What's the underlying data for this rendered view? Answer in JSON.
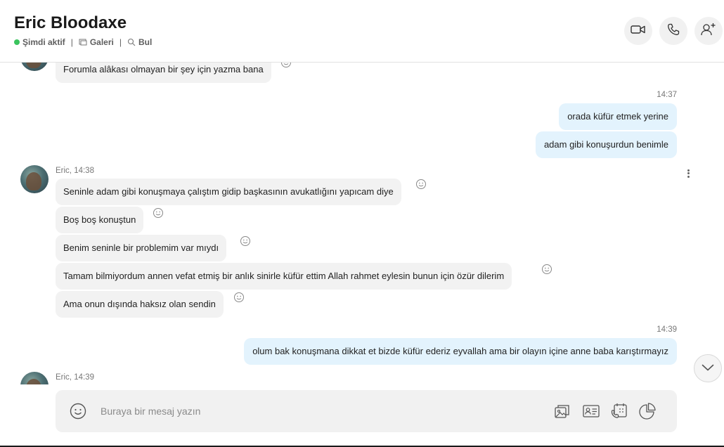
{
  "contact": {
    "name": "Eric Bloodaxe",
    "status": "Şimdi aktif",
    "gallery_label": "Galeri",
    "find_label": "Bul",
    "separator": "|"
  },
  "header_actions": {
    "video_icon": "video-camera-icon",
    "call_icon": "phone-icon",
    "add_people_icon": "add-person-icon"
  },
  "messages": {
    "m0": {
      "text": "Forumla alâkası olmayan bir şey için yazma bana"
    },
    "out1_time": "14:37",
    "m1": {
      "text": "orada küfür etmek yerine"
    },
    "m2": {
      "text": "adam gibi konuşurdun benimle"
    },
    "in2_meta": "Eric, 14:38",
    "m3": {
      "text": "Seninle adam gibi konuşmaya çalıştım gidip başkasının avukatlığını yapıcam diye"
    },
    "m4": {
      "text": "Boş boş konuştun"
    },
    "m5": {
      "text": "Benim seninle bir problemim var mıydı"
    },
    "m6": {
      "text": "Tamam bilmiyordum annen vefat etmiş bir anlık sinirle küfür ettim Allah rahmet eylesin bunun için özür dilerim"
    },
    "m7": {
      "text": "Ama onun dışında haksız olan sendin"
    },
    "out2_time": "14:39",
    "m8": {
      "text": "olum bak konuşmana dikkat et bizde küfür ederiz eyvallah ama bir olayın içine anne baba karıştırmayız"
    },
    "in3_meta": "Eric, 14:39"
  },
  "composer": {
    "placeholder": "Buraya bir mesaj yazın",
    "icons": [
      "emoji-icon",
      "media-gallery-icon",
      "contact-card-icon",
      "schedule-call-icon",
      "poll-icon"
    ]
  },
  "colors": {
    "incoming_bubble": "#f2f2f2",
    "outgoing_bubble": "#e3f3fd",
    "active_dot": "#3bc45e"
  }
}
